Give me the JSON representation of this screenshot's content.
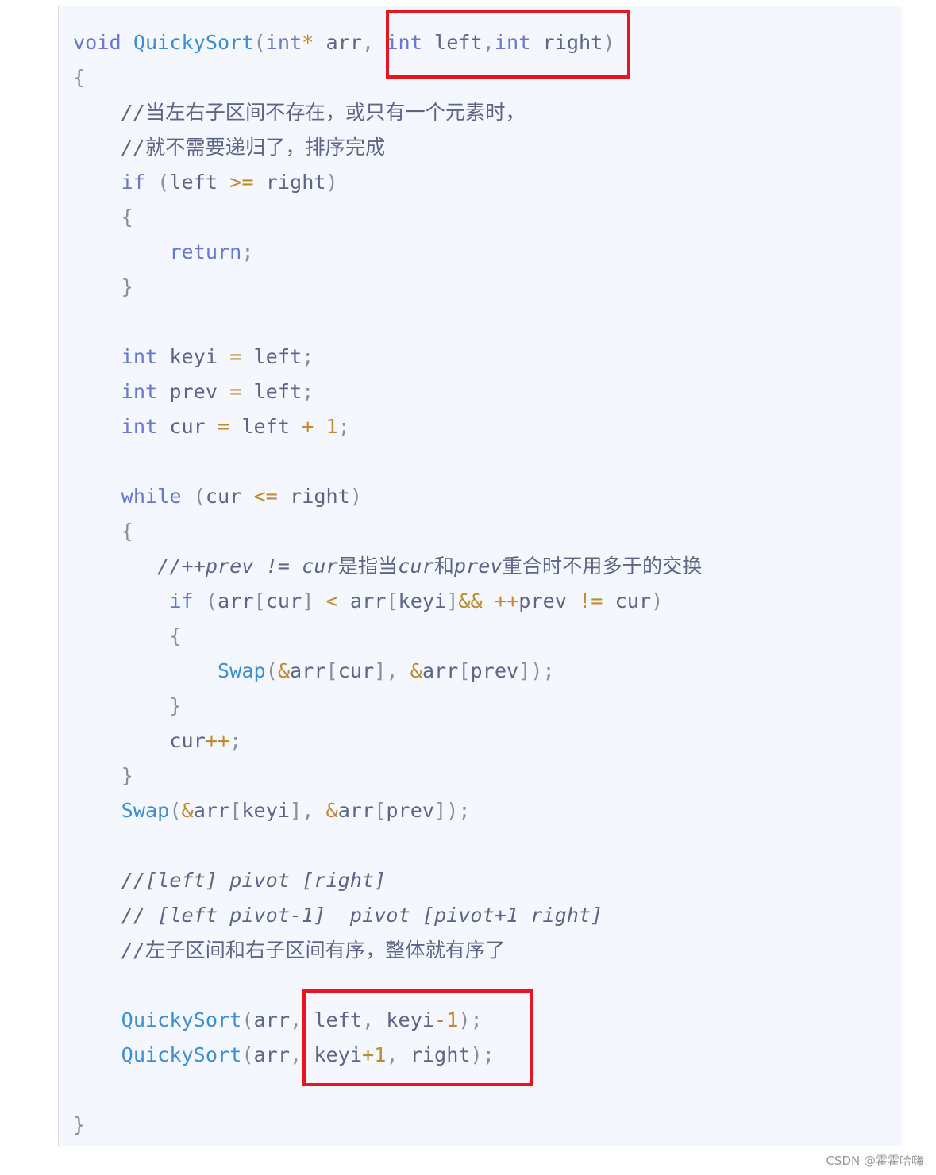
{
  "code_lines": [
    {
      "indent": 0,
      "tokens": [
        [
          "kw",
          "void"
        ],
        [
          "id",
          " "
        ],
        [
          "fn",
          "QuickySort"
        ],
        [
          "p",
          "("
        ],
        [
          "kw",
          "int"
        ],
        [
          "op",
          "*"
        ],
        [
          "id",
          " arr"
        ],
        [
          "p",
          ", "
        ],
        [
          "kw",
          "int"
        ],
        [
          "id",
          " left"
        ],
        [
          "p",
          ","
        ],
        [
          "kw",
          "int"
        ],
        [
          "id",
          " right"
        ],
        [
          "p",
          ")"
        ]
      ]
    },
    {
      "indent": 0,
      "tokens": [
        [
          "p",
          "{"
        ]
      ]
    },
    {
      "indent": 4,
      "tokens": [
        [
          "cm",
          "//当左右子区间不存在，或只有一个元素时，"
        ]
      ]
    },
    {
      "indent": 4,
      "tokens": [
        [
          "cm",
          "//就不需要递归了，排序完成"
        ]
      ]
    },
    {
      "indent": 4,
      "tokens": [
        [
          "kw",
          "if"
        ],
        [
          "p",
          " ("
        ],
        [
          "id",
          "left "
        ],
        [
          "op",
          ">="
        ],
        [
          "id",
          " right"
        ],
        [
          "p",
          ")"
        ]
      ]
    },
    {
      "indent": 4,
      "tokens": [
        [
          "p",
          "{"
        ]
      ]
    },
    {
      "indent": 8,
      "tokens": [
        [
          "kw",
          "return"
        ],
        [
          "p",
          ";"
        ]
      ]
    },
    {
      "indent": 4,
      "tokens": [
        [
          "p",
          "}"
        ]
      ]
    },
    {
      "indent": 0,
      "tokens": []
    },
    {
      "indent": 4,
      "tokens": [
        [
          "kw",
          "int"
        ],
        [
          "id",
          " keyi "
        ],
        [
          "op",
          "="
        ],
        [
          "id",
          " left"
        ],
        [
          "p",
          ";"
        ]
      ]
    },
    {
      "indent": 4,
      "tokens": [
        [
          "kw",
          "int"
        ],
        [
          "id",
          " prev "
        ],
        [
          "op",
          "="
        ],
        [
          "id",
          " left"
        ],
        [
          "p",
          ";"
        ]
      ]
    },
    {
      "indent": 4,
      "tokens": [
        [
          "kw",
          "int"
        ],
        [
          "id",
          " cur "
        ],
        [
          "op",
          "="
        ],
        [
          "id",
          " left "
        ],
        [
          "op",
          "+"
        ],
        [
          "id",
          " "
        ],
        [
          "num",
          "1"
        ],
        [
          "p",
          ";"
        ]
      ]
    },
    {
      "indent": 0,
      "tokens": []
    },
    {
      "indent": 4,
      "tokens": [
        [
          "kw",
          "while"
        ],
        [
          "p",
          " ("
        ],
        [
          "id",
          "cur "
        ],
        [
          "op",
          "<="
        ],
        [
          "id",
          " right"
        ],
        [
          "p",
          ")"
        ]
      ]
    },
    {
      "indent": 4,
      "tokens": [
        [
          "p",
          "{"
        ]
      ]
    },
    {
      "indent": 7,
      "tokens": [
        [
          "cm",
          "//++prev != cur是指当cur和prev重合时不用多于的交换"
        ]
      ]
    },
    {
      "indent": 8,
      "tokens": [
        [
          "kw",
          "if"
        ],
        [
          "p",
          " ("
        ],
        [
          "id",
          "arr"
        ],
        [
          "p",
          "["
        ],
        [
          "id",
          "cur"
        ],
        [
          "p",
          "]"
        ],
        [
          "id",
          " "
        ],
        [
          "op",
          "<"
        ],
        [
          "id",
          " arr"
        ],
        [
          "p",
          "["
        ],
        [
          "id",
          "keyi"
        ],
        [
          "p",
          "]"
        ],
        [
          "op",
          "&&"
        ],
        [
          "id",
          " "
        ],
        [
          "op",
          "++"
        ],
        [
          "id",
          "prev "
        ],
        [
          "op",
          "!="
        ],
        [
          "id",
          " cur"
        ],
        [
          "p",
          ")"
        ]
      ]
    },
    {
      "indent": 8,
      "tokens": [
        [
          "p",
          "{"
        ]
      ]
    },
    {
      "indent": 12,
      "tokens": [
        [
          "fn",
          "Swap"
        ],
        [
          "p",
          "("
        ],
        [
          "op",
          "&"
        ],
        [
          "id",
          "arr"
        ],
        [
          "p",
          "["
        ],
        [
          "id",
          "cur"
        ],
        [
          "p",
          "], "
        ],
        [
          "op",
          "&"
        ],
        [
          "id",
          "arr"
        ],
        [
          "p",
          "["
        ],
        [
          "id",
          "prev"
        ],
        [
          "p",
          "]);"
        ]
      ]
    },
    {
      "indent": 8,
      "tokens": [
        [
          "p",
          "}"
        ]
      ]
    },
    {
      "indent": 8,
      "tokens": [
        [
          "id",
          "cur"
        ],
        [
          "op",
          "++"
        ],
        [
          "p",
          ";"
        ]
      ]
    },
    {
      "indent": 4,
      "tokens": [
        [
          "p",
          "}"
        ]
      ]
    },
    {
      "indent": 4,
      "tokens": [
        [
          "fn",
          "Swap"
        ],
        [
          "p",
          "("
        ],
        [
          "op",
          "&"
        ],
        [
          "id",
          "arr"
        ],
        [
          "p",
          "["
        ],
        [
          "id",
          "keyi"
        ],
        [
          "p",
          "], "
        ],
        [
          "op",
          "&"
        ],
        [
          "id",
          "arr"
        ],
        [
          "p",
          "["
        ],
        [
          "id",
          "prev"
        ],
        [
          "p",
          "]);"
        ]
      ]
    },
    {
      "indent": 0,
      "tokens": []
    },
    {
      "indent": 4,
      "tokens": [
        [
          "cm",
          "//[left] pivot [right]"
        ]
      ]
    },
    {
      "indent": 4,
      "tokens": [
        [
          "cm",
          "// [left pivot-1]  pivot [pivot+1 right]"
        ]
      ]
    },
    {
      "indent": 4,
      "tokens": [
        [
          "cm",
          "//左子区间和右子区间有序，整体就有序了"
        ]
      ]
    },
    {
      "indent": 0,
      "tokens": []
    },
    {
      "indent": 4,
      "tokens": [
        [
          "fn",
          "QuickySort"
        ],
        [
          "p",
          "("
        ],
        [
          "id",
          "arr"
        ],
        [
          "p",
          ", "
        ],
        [
          "id",
          "left"
        ],
        [
          "p",
          ", "
        ],
        [
          "id",
          "keyi"
        ],
        [
          "op",
          "-"
        ],
        [
          "num",
          "1"
        ],
        [
          "p",
          ");"
        ]
      ]
    },
    {
      "indent": 4,
      "tokens": [
        [
          "fn",
          "QuickySort"
        ],
        [
          "p",
          "("
        ],
        [
          "id",
          "arr"
        ],
        [
          "p",
          ", "
        ],
        [
          "id",
          "keyi"
        ],
        [
          "op",
          "+"
        ],
        [
          "num",
          "1"
        ],
        [
          "p",
          ", "
        ],
        [
          "id",
          "right"
        ],
        [
          "p",
          ");"
        ]
      ]
    },
    {
      "indent": 0,
      "tokens": []
    },
    {
      "indent": 0,
      "tokens": [
        [
          "p",
          "}"
        ]
      ]
    }
  ],
  "highlight_color": "#e8141f",
  "watermark": "CSDN @霍霍哈嗨"
}
